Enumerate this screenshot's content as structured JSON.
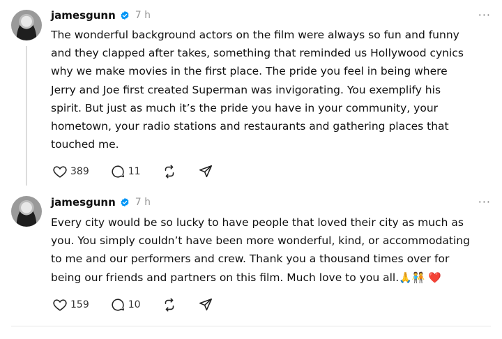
{
  "posts": [
    {
      "username": "jamesgunn",
      "time": "7 h",
      "more": "···",
      "lines": [
        "The wonderful background actors on the film were always so fun and funny",
        "and they clapped after takes, something that reminded us Hollywood cynics",
        "why we make movies in the first place. The pride you feel in being where",
        "Jerry and Joe first created Superman was invigorating. You exemplify his",
        "spirit. But just as much it’s the pride you have in your community, your",
        "hometown, your radio stations and restaurants and gathering places that",
        "touched me."
      ],
      "likes": "389",
      "replies": "11"
    },
    {
      "username": "jamesgunn",
      "time": "7 h",
      "more": "···",
      "lines": [
        "Every city would be so lucky to have people that loved their city as much as",
        "you. You simply couldn’t have been more wonderful, kind, or accommodating",
        "to me and our performers and crew. Thank you a thousand times over for",
        "being our friends and partners on this film. Much love to you all."
      ],
      "emojis": "🙏🧑‍🤝‍🧑 ❤️",
      "likes": "159",
      "replies": "10"
    }
  ],
  "icons": {
    "verified": "verified-badge-icon",
    "like": "heart-icon",
    "reply": "comment-icon",
    "repost": "repost-icon",
    "share": "send-icon"
  },
  "colors": {
    "verified": "#0095f6",
    "heart": "#e0245e"
  }
}
